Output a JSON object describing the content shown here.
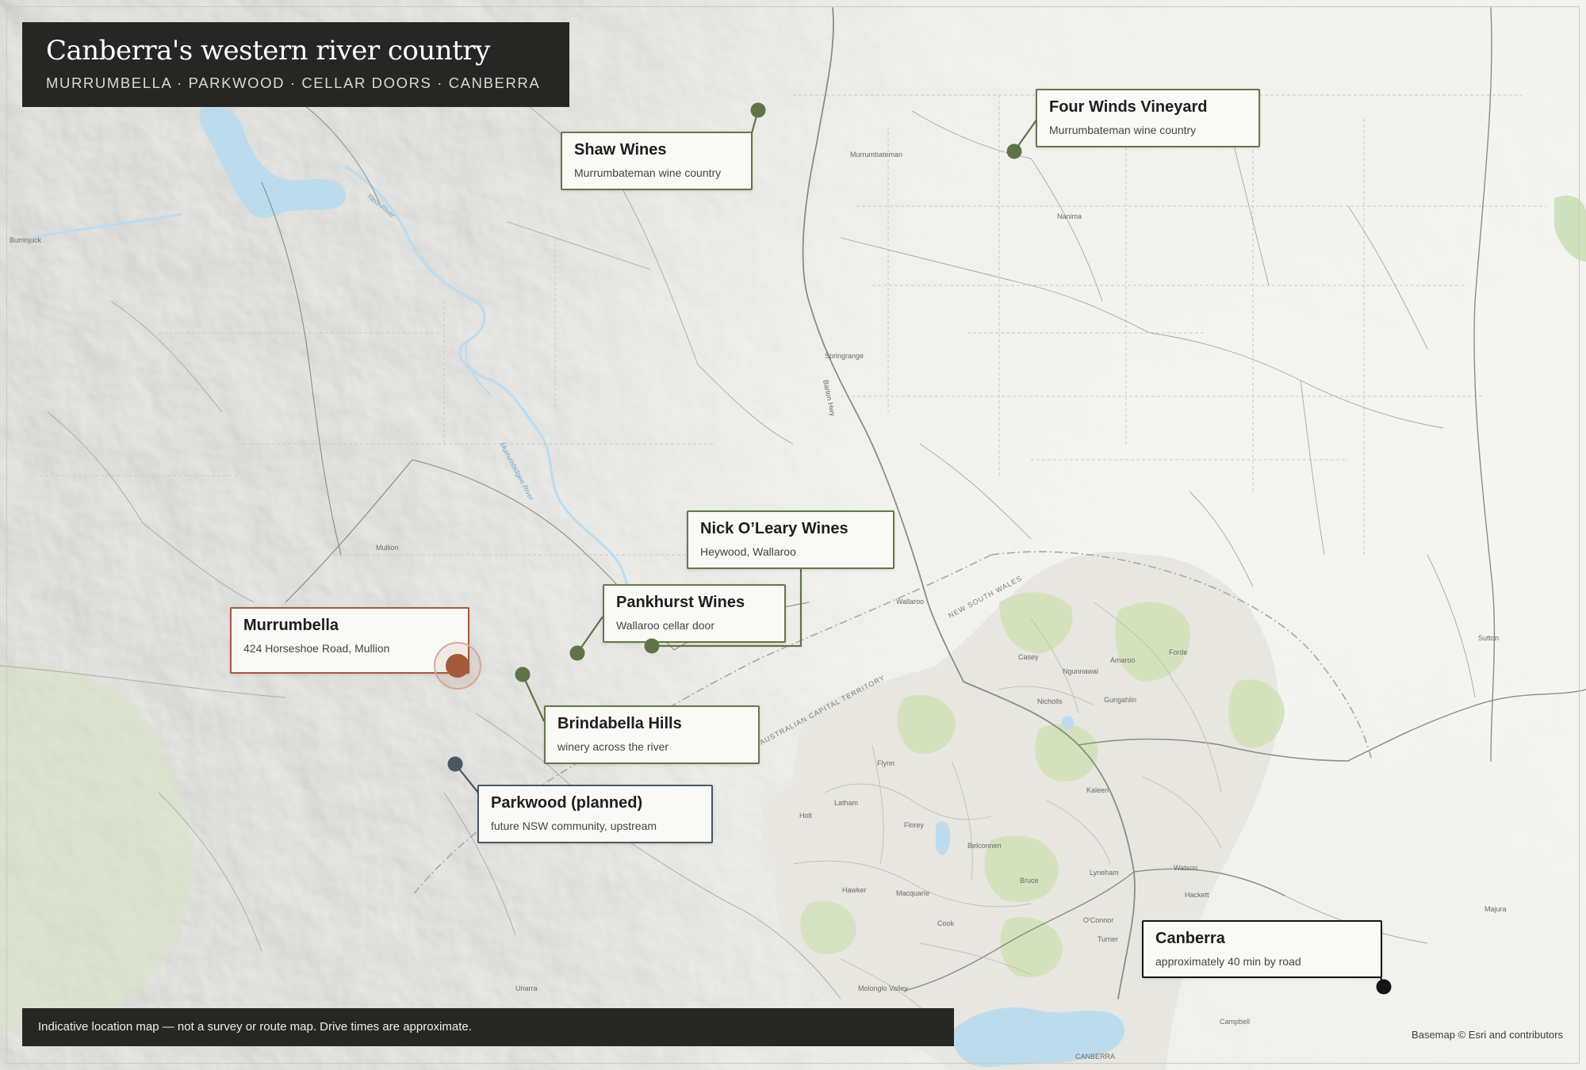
{
  "map": {
    "title": "Canberra's western river country",
    "subtitle": "MURRUMBELLA · PARKWOOD · CELLAR DOORS · CANBERRA",
    "disclaimer": "Indicative location map — not a survey or route map. Drive times are approximate.",
    "credit": "Basemap © Esri and contributors"
  },
  "colors": {
    "featured": "#a45a3c",
    "winery": "#5f7446",
    "planned": "#4a5866",
    "city": "#151515",
    "panel": "#262624"
  },
  "places": {
    "shaw": {
      "name": "Shaw Wines",
      "desc": "Murrumbateman wine country"
    },
    "four_winds": {
      "name": "Four Winds Vineyard",
      "desc": "Murrumbateman wine country"
    },
    "nick_oleary": {
      "name": "Nick O’Leary Wines",
      "desc": "Heywood, Wallaroo"
    },
    "pankhurst": {
      "name": "Pankhurst Wines",
      "desc": "Wallaroo cellar door"
    },
    "murrumbella": {
      "name": "Murrumbella",
      "desc": "424 Horseshoe Road, Mullion"
    },
    "brindabella": {
      "name": "Brindabella Hills",
      "desc": "winery across the river"
    },
    "parkwood": {
      "name": "Parkwood (planned)",
      "desc": "future NSW community, upstream"
    },
    "canberra": {
      "name": "Canberra",
      "desc": "approximately 40 min by road"
    }
  },
  "basemap_labels": {
    "murrumbateman": "Murrumbateman",
    "nanima": "Nanima",
    "springrange": "Springrange",
    "wallaroo": "Wallaroo",
    "mullion": "Mullion",
    "nsw_border": "NEW SOUTH WALES",
    "act_border": "AUSTRALIAN CAPITAL TERRITORY",
    "nicholls": "Nicholls",
    "ngunnawal": "Ngunnawal",
    "amaroo": "Amaroo",
    "gungahlin": "Gungahlin",
    "forde": "Forde",
    "casey": "Casey",
    "kaleen": "Kaleen",
    "belconnen": "Belconnen",
    "holt": "Holt",
    "latham": "Latham",
    "florey": "Florey",
    "flynn": "Flynn",
    "macquarie": "Macquarie",
    "hawker": "Hawker",
    "bruce": "Bruce",
    "lyneham": "Lyneham",
    "watson": "Watson",
    "hackett": "Hackett",
    "oconnor": "O'Connor",
    "turner": "Turner",
    "cook": "Cook",
    "campbell": "Campbell",
    "canberra_city": "CANBERRA",
    "yass_river": "Yass River",
    "murrumbidgee": "Murrumbidgee River",
    "molonglo": "Molonglo Valley",
    "uriarra": "Uriarra",
    "sutton": "Sutton",
    "burrinjuck": "Burrinjuck",
    "barton_hwy": "Barton Hwy",
    "majura": "Majura"
  }
}
